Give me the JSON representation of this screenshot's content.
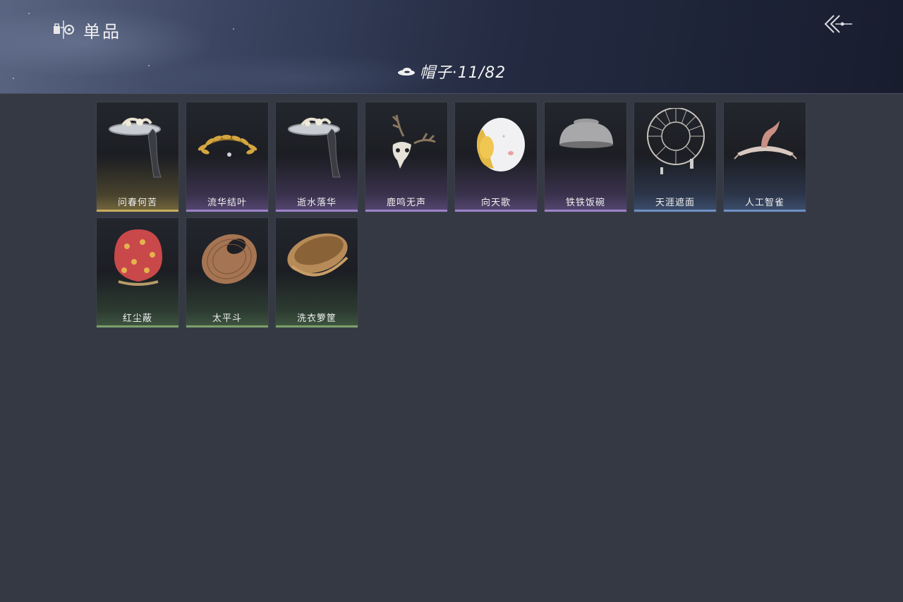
{
  "header": {
    "title": "单品",
    "title_icon": "wardrobe-icon",
    "back_icon": "back-arrow-icon"
  },
  "category": {
    "icon": "hat-icon",
    "label": "帽子",
    "separator": "·",
    "count": "11/82"
  },
  "rarity_colors": {
    "gold": "#c7ac5d",
    "purple": "#9b82c8",
    "blue": "#6d8fc4",
    "green": "#7aa06c"
  },
  "items": [
    {
      "name": "问春何苦",
      "rarity": "gold",
      "icon": "veiled-hat-icon"
    },
    {
      "name": "流华结叶",
      "rarity": "purple",
      "icon": "golden-leaf-crown-icon"
    },
    {
      "name": "逝水落华",
      "rarity": "purple",
      "icon": "veiled-hat-icon"
    },
    {
      "name": "鹿鸣无声",
      "rarity": "purple",
      "icon": "deer-skull-icon"
    },
    {
      "name": "向天歌",
      "rarity": "purple",
      "icon": "duck-hood-icon"
    },
    {
      "name": "铁铁饭碗",
      "rarity": "purple",
      "icon": "iron-bowl-icon"
    },
    {
      "name": "天涯遮面",
      "rarity": "blue",
      "icon": "wheel-hat-icon"
    },
    {
      "name": "人工智雀",
      "rarity": "blue",
      "icon": "bird-hat-icon"
    },
    {
      "name": "红尘蔽",
      "rarity": "green",
      "icon": "red-hood-icon"
    },
    {
      "name": "太平斗",
      "rarity": "green",
      "icon": "wicker-hat-icon"
    },
    {
      "name": "洗衣箩筐",
      "rarity": "green",
      "icon": "basket-icon"
    }
  ]
}
